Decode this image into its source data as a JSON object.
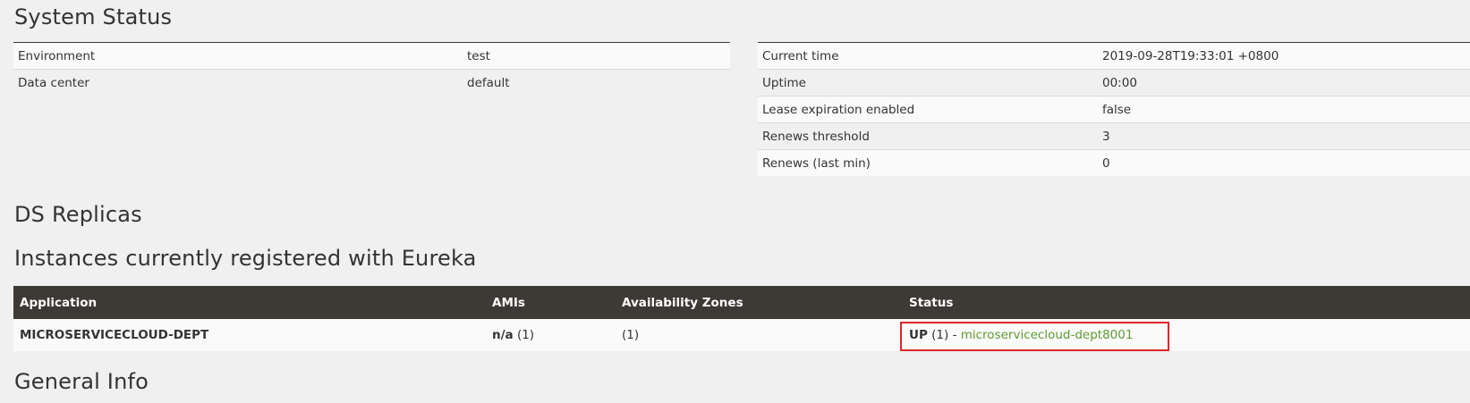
{
  "headings": {
    "system_status": "System Status",
    "ds_replicas": "DS Replicas",
    "instances": "Instances currently registered with Eureka",
    "general_info": "General Info"
  },
  "environment": [
    {
      "key": "Environment",
      "value": "test"
    },
    {
      "key": "Data center",
      "value": "default"
    }
  ],
  "status_info": [
    {
      "key": "Current time",
      "value": "2019-09-28T19:33:01 +0800"
    },
    {
      "key": "Uptime",
      "value": "00:00"
    },
    {
      "key": "Lease expiration enabled",
      "value": "false"
    },
    {
      "key": "Renews threshold",
      "value": "3"
    },
    {
      "key": "Renews (last min)",
      "value": "0"
    }
  ],
  "instances_table": {
    "columns": [
      "Application",
      "AMIs",
      "Availability Zones",
      "Status"
    ],
    "rows": [
      {
        "application": "MICROSERVICECLOUD-DEPT",
        "amis_label": "n/a",
        "amis_count": "(1)",
        "zones": "(1)",
        "status_state": "UP",
        "status_count": "(1) - ",
        "status_link": "microservicecloud-dept8001"
      }
    ]
  },
  "colors": {
    "header_bg": "#3d3935",
    "link": "#5d9b32",
    "highlight": "#e0262b",
    "page_bg": "#f0f0f0"
  }
}
